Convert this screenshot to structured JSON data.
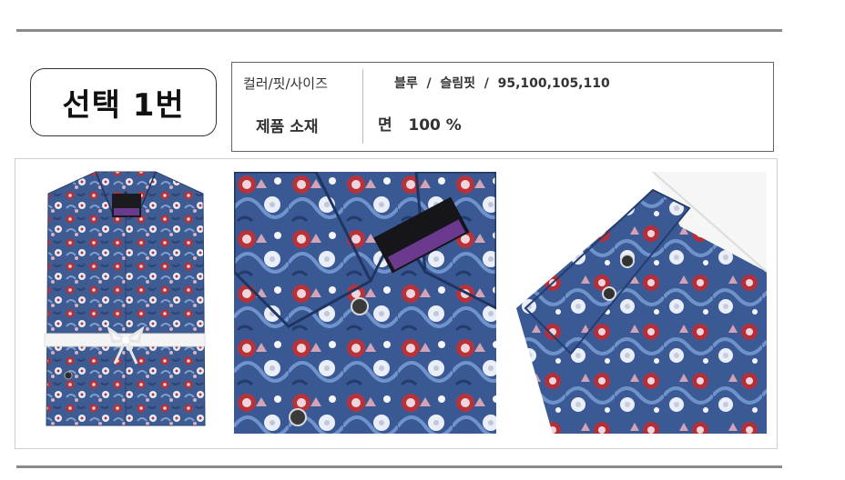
{
  "header": {
    "title": "선택 1번"
  },
  "spec": {
    "color_fit_size_label": "컬러/핏/사이즈",
    "color_fit_size_value": "블루  /  슬림핏  /  95,100,105,110",
    "material_label": "제품 소재",
    "material_value": "면   100 %"
  },
  "photos": [
    {
      "name": "folded-shirt"
    },
    {
      "name": "collar-closeup"
    },
    {
      "name": "cuff-closeup"
    }
  ],
  "colors": {
    "fabric": "#3e5b92",
    "flower_red": "#b8323a",
    "rule": "#8a8a8a"
  }
}
